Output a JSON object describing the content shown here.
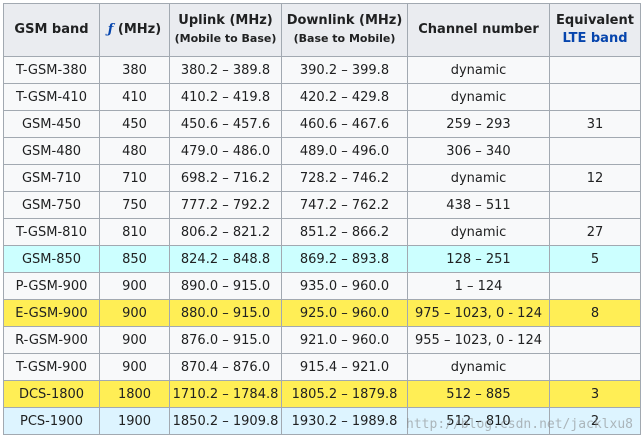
{
  "header": {
    "band": "GSM band",
    "f_symbol": "ƒ",
    "f_unit": "(MHz)",
    "uplink": "Uplink (MHz)",
    "uplink_sub": "(Mobile to Base)",
    "downlink": "Downlink (MHz)",
    "downlink_sub": "(Base to Mobile)",
    "channel": "Channel number",
    "equivalent": "Equivalent",
    "lte_link": "LTE band"
  },
  "rows": [
    {
      "band": "T-GSM-380",
      "f": "380",
      "uplink": "380.2 – 389.8",
      "downlink": "390.2 – 399.8",
      "channel": "dynamic",
      "lte": ""
    },
    {
      "band": "T-GSM-410",
      "f": "410",
      "uplink": "410.2 – 419.8",
      "downlink": "420.2 – 429.8",
      "channel": "dynamic",
      "lte": ""
    },
    {
      "band": "GSM-450",
      "f": "450",
      "uplink": "450.6 – 457.6",
      "downlink": "460.6 – 467.6",
      "channel": "259 – 293",
      "lte": "31"
    },
    {
      "band": "GSM-480",
      "f": "480",
      "uplink": "479.0 – 486.0",
      "downlink": "489.0 – 496.0",
      "channel": "306 – 340",
      "lte": ""
    },
    {
      "band": "GSM-710",
      "f": "710",
      "uplink": "698.2 – 716.2",
      "downlink": "728.2 – 746.2",
      "channel": "dynamic",
      "lte": "12"
    },
    {
      "band": "GSM-750",
      "f": "750",
      "uplink": "777.2 – 792.2",
      "downlink": "747.2 – 762.2",
      "channel": "438 – 511",
      "lte": ""
    },
    {
      "band": "T-GSM-810",
      "f": "810",
      "uplink": "806.2 – 821.2",
      "downlink": "851.2 – 866.2",
      "channel": "dynamic",
      "lte": "27"
    },
    {
      "band": "GSM-850",
      "f": "850",
      "uplink": "824.2 – 848.8",
      "downlink": "869.2 – 893.8",
      "channel": "128 – 251",
      "lte": "5"
    },
    {
      "band": "P-GSM-900",
      "f": "900",
      "uplink": "890.0 – 915.0",
      "downlink": "935.0 – 960.0",
      "channel": "1 – 124",
      "lte": ""
    },
    {
      "band": "E-GSM-900",
      "f": "900",
      "uplink": "880.0 – 915.0",
      "downlink": "925.0 – 960.0",
      "channel": "975 – 1023, 0 - 124",
      "lte": "8"
    },
    {
      "band": "R-GSM-900",
      "f": "900",
      "uplink": "876.0 – 915.0",
      "downlink": "921.0 – 960.0",
      "channel": "955 – 1023, 0 - 124",
      "lte": ""
    },
    {
      "band": "T-GSM-900",
      "f": "900",
      "uplink": "870.4 – 876.0",
      "downlink": "915.4 – 921.0",
      "channel": "dynamic",
      "lte": ""
    },
    {
      "band": "DCS-1800",
      "f": "1800",
      "uplink": "1710.2 – 1784.8",
      "downlink": "1805.2 – 1879.8",
      "channel": "512 – 885",
      "lte": "3"
    },
    {
      "band": "PCS-1900",
      "f": "1900",
      "uplink": "1850.2 – 1909.8",
      "downlink": "1930.2 – 1989.8",
      "channel": "512 – 810",
      "lte": "2"
    }
  ],
  "watermark": "http://blog.csdn.net/jacklxu8",
  "colors": {
    "header_bg": "#eaecf0",
    "cell_bg": "#f8f9fa",
    "border": "#a2a9b1",
    "link": "#0645ad",
    "highlight_cyan": "#ccffff",
    "highlight_yellow": "#ffee55",
    "highlight_light": "#ddf4ff"
  }
}
